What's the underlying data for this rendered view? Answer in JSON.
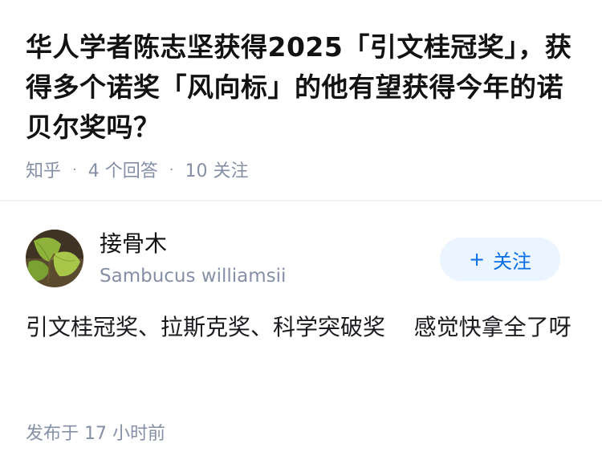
{
  "question": {
    "title": "华人学者陈志坚获得2025「引文桂冠奖」，获得多个诺奖「风向标」的他有望获得今年的诺贝尔奖吗？",
    "source": "知乎",
    "answer_count": "4 个回答",
    "follower_count": "10 关注"
  },
  "answer": {
    "author_name": "接骨木",
    "author_bio": "Sambucus williamsii",
    "follow_label": "关注",
    "follow_plus": "+",
    "content": "引文桂冠奖、拉斯克奖、科学突破奖    感觉快拿全了呀",
    "published": "发布于  17 小时前"
  },
  "colors": {
    "meta_gray": "#8590a6",
    "follow_blue": "#056de8",
    "follow_bg": "#ebf5ff"
  },
  "icons": {
    "avatar": "ginkgo-leaf-avatar"
  }
}
